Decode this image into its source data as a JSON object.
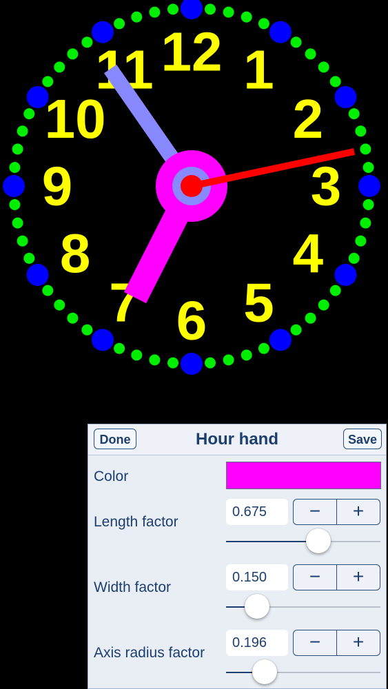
{
  "clock": {
    "numerals": [
      "12",
      "1",
      "2",
      "3",
      "4",
      "5",
      "6",
      "7",
      "8",
      "9",
      "10",
      "11"
    ],
    "numeral_color": "#ffff00",
    "minute_dot_color": "#00ee00",
    "hour_dot_color": "#0000ff",
    "hour_hand_color": "#ff00ff",
    "minute_hand_color": "#8888ff",
    "second_hand_color": "#ff0000",
    "axis_color": "#ff00ff",
    "axis_inner_color": "#8888ff",
    "center_color": "#ff0000"
  },
  "panel": {
    "title": "Hour hand",
    "done_label": "Done",
    "save_label": "Save",
    "color_label": "Color",
    "color_value": "#ff00ff",
    "params": [
      {
        "label": "Length factor",
        "value": "0.675",
        "minus": "−",
        "plus": "+",
        "slider": 0.6
      },
      {
        "label": "Width factor",
        "value": "0.150",
        "minus": "−",
        "plus": "+",
        "slider": 0.2
      },
      {
        "label": "Axis radius factor",
        "value": "0.196",
        "minus": "−",
        "plus": "+",
        "slider": 0.25
      }
    ]
  }
}
